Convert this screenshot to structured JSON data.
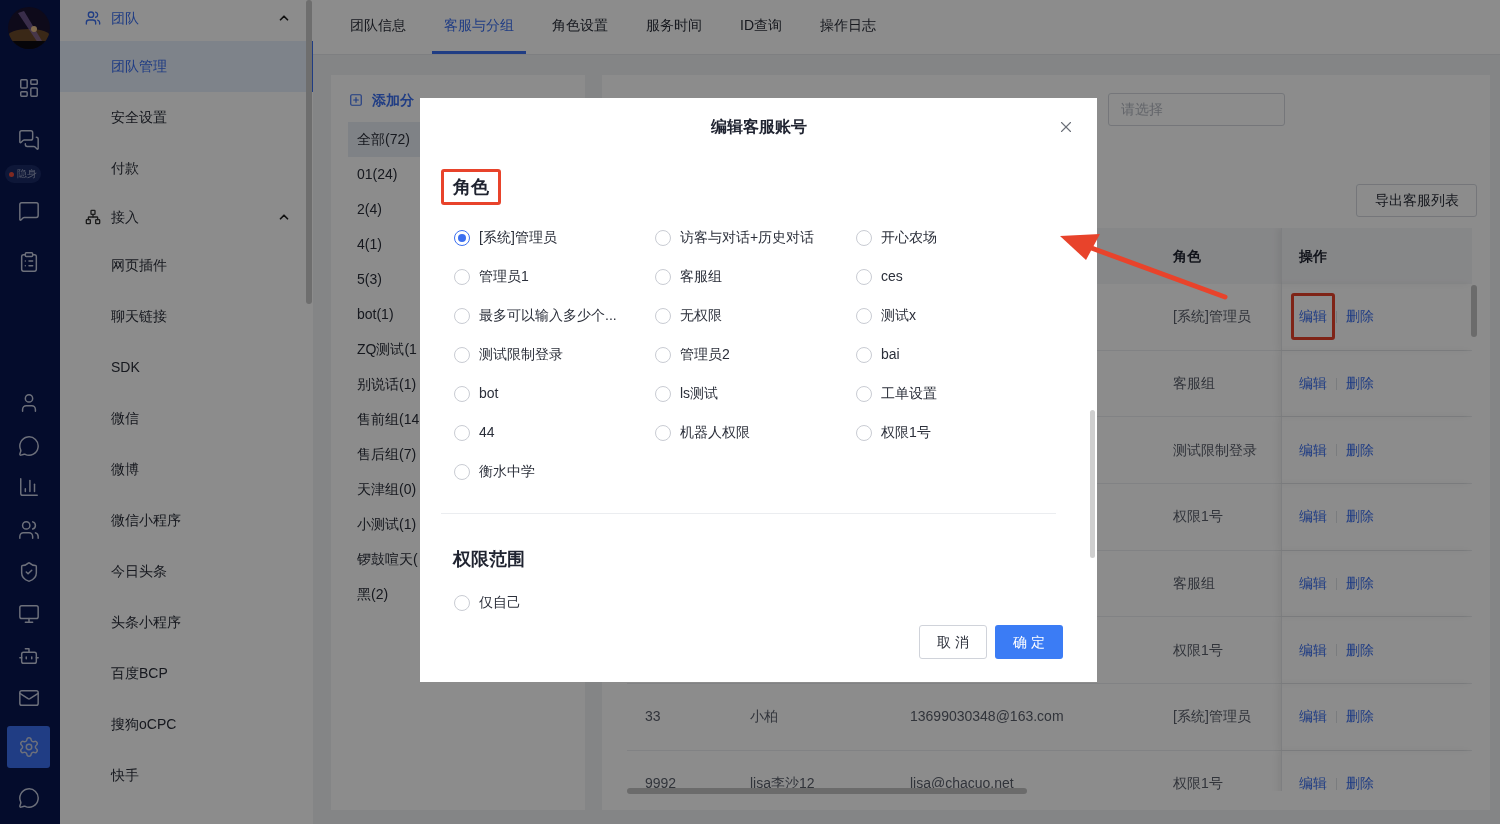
{
  "rail": {
    "status_badge": "隐身",
    "items": [
      {
        "selected": false
      },
      {
        "selected": false
      },
      {
        "selected": false
      },
      {
        "selected": false
      },
      {
        "selected": false
      },
      {
        "selected": false
      },
      {
        "selected": false
      },
      {
        "selected": false
      },
      {
        "selected": false
      },
      {
        "selected": false
      },
      {
        "selected": false
      },
      {
        "selected": false
      },
      {
        "selected": true
      },
      {
        "selected": false
      }
    ]
  },
  "menu": [
    {
      "title": "团队",
      "expanded": true,
      "items": [
        {
          "label": "团队管理",
          "selected": true
        },
        {
          "label": "安全设置",
          "selected": false
        },
        {
          "label": "付款",
          "selected": false
        }
      ]
    },
    {
      "title": "接入",
      "expanded": true,
      "items": [
        {
          "label": "网页插件",
          "selected": false
        },
        {
          "label": "聊天链接",
          "selected": false
        },
        {
          "label": "SDK",
          "selected": false
        },
        {
          "label": "微信",
          "selected": false
        },
        {
          "label": "微博",
          "selected": false
        },
        {
          "label": "微信小程序",
          "selected": false
        },
        {
          "label": "今日头条",
          "selected": false
        },
        {
          "label": "头条小程序",
          "selected": false
        },
        {
          "label": "百度BCP",
          "selected": false
        },
        {
          "label": "搜狗oCPC",
          "selected": false
        },
        {
          "label": "快手",
          "selected": false
        }
      ]
    }
  ],
  "tabs": [
    {
      "label": "团队信息",
      "selected": false
    },
    {
      "label": "客服与分组",
      "selected": true
    },
    {
      "label": "角色设置",
      "selected": false
    },
    {
      "label": "服务时间",
      "selected": false
    },
    {
      "label": "ID查询",
      "selected": false
    },
    {
      "label": "操作日志",
      "selected": false
    }
  ],
  "groups": {
    "add_label": "添加分",
    "items": [
      {
        "label": "全部(72)",
        "selected": true
      },
      {
        "label": "01(24)",
        "selected": false
      },
      {
        "label": "2(4)",
        "selected": false
      },
      {
        "label": "4(1)",
        "selected": false
      },
      {
        "label": "5(3)",
        "selected": false
      },
      {
        "label": "bot(1)",
        "selected": false
      },
      {
        "label": "ZQ测试(1",
        "selected": false
      },
      {
        "label": "别说话(1)",
        "selected": false
      },
      {
        "label": "售前组(14",
        "selected": false
      },
      {
        "label": "售后组(7)",
        "selected": false
      },
      {
        "label": "天津组(0)",
        "selected": false
      },
      {
        "label": "小测试(1)",
        "selected": false
      },
      {
        "label": "锣鼓喧天(",
        "selected": false
      },
      {
        "label": "黑(2)",
        "selected": false
      }
    ]
  },
  "filter": {
    "placeholder": "请选择"
  },
  "export_button": "导出客服列表",
  "table": {
    "columns": [
      "角色",
      "操作"
    ],
    "rows": [
      {
        "role": "[系统]管理员",
        "edit": "编辑",
        "delete": "删除",
        "highlighted": true
      },
      {
        "role": "客服组",
        "edit": "编辑",
        "delete": "删除"
      },
      {
        "role": "测试限制登录",
        "edit": "编辑",
        "delete": "删除"
      },
      {
        "role": "权限1号",
        "edit": "编辑",
        "delete": "删除"
      },
      {
        "role": "客服组",
        "edit": "编辑",
        "delete": "删除"
      },
      {
        "role": "权限1号",
        "edit": "编辑",
        "delete": "删除"
      },
      {
        "id": "33",
        "name": "小柏",
        "account": "13699030348@163.com",
        "role": "[系统]管理员",
        "edit": "编辑",
        "delete": "删除"
      },
      {
        "id": "9992",
        "name": "lisa李沙12",
        "account": "lisa@chacuo.net",
        "role": "权限1号",
        "edit": "编辑",
        "delete": "删除"
      }
    ]
  },
  "modal": {
    "title": "编辑客服账号",
    "sections": [
      {
        "title": "角色",
        "highlighted": true,
        "options": [
          {
            "label": "[系统]管理员",
            "selected": true
          },
          {
            "label": "访客与对话+历史对话",
            "selected": false
          },
          {
            "label": "开心农场",
            "selected": false
          },
          {
            "label": "管理员1",
            "selected": false
          },
          {
            "label": "客服组",
            "selected": false
          },
          {
            "label": "ces",
            "selected": false
          },
          {
            "label": "最多可以输入多少个...",
            "selected": false
          },
          {
            "label": "无权限",
            "selected": false
          },
          {
            "label": "测试x",
            "selected": false
          },
          {
            "label": "测试限制登录",
            "selected": false
          },
          {
            "label": "管理员2",
            "selected": false
          },
          {
            "label": "bai",
            "selected": false
          },
          {
            "label": "bot",
            "selected": false
          },
          {
            "label": "ls测试",
            "selected": false
          },
          {
            "label": "工单设置",
            "selected": false
          },
          {
            "label": "44",
            "selected": false
          },
          {
            "label": "机器人权限",
            "selected": false
          },
          {
            "label": "权限1号",
            "selected": false
          },
          {
            "label": "衡水中学",
            "selected": false
          }
        ]
      },
      {
        "title": "权限范围",
        "highlighted": false,
        "options": [
          {
            "label": "仅自己",
            "selected": false
          }
        ]
      }
    ],
    "cancel": "取消",
    "confirm": "确定"
  }
}
